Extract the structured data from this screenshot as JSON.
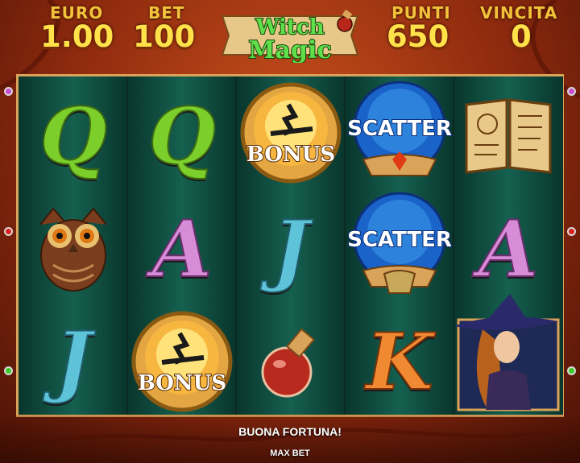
{
  "header": {
    "euro_label": "EURO",
    "euro_value": "1.00",
    "bet_label": "BET",
    "bet_value": "100",
    "punti_label": "PUNTI",
    "punti_value": "650",
    "vincita_label": "VINCITA",
    "vincita_value": "0"
  },
  "logo": {
    "line1": "Witch",
    "line2": "Magic"
  },
  "reels": [
    {
      "symbols": [
        {
          "type": "letter",
          "text": "Q",
          "style": "q"
        },
        {
          "type": "owl",
          "name": "owl-icon"
        },
        {
          "type": "letter",
          "text": "J",
          "style": "j"
        }
      ]
    },
    {
      "symbols": [
        {
          "type": "letter",
          "text": "Q",
          "style": "q"
        },
        {
          "type": "letter",
          "text": "A",
          "style": "a"
        },
        {
          "type": "bonus",
          "text": "BONUS"
        }
      ]
    },
    {
      "symbols": [
        {
          "type": "bonus",
          "text": "BONUS"
        },
        {
          "type": "letter",
          "text": "J",
          "style": "j"
        },
        {
          "type": "potion",
          "name": "potion-icon"
        }
      ]
    },
    {
      "symbols": [
        {
          "type": "scatter",
          "text": "SCATTER"
        },
        {
          "type": "scatter",
          "text": "SCATTER"
        },
        {
          "type": "letter",
          "text": "K",
          "style": "k"
        }
      ]
    },
    {
      "symbols": [
        {
          "type": "book",
          "name": "spellbook-icon"
        },
        {
          "type": "letter",
          "text": "A",
          "style": "a"
        },
        {
          "type": "witch",
          "name": "witch-icon"
        }
      ]
    }
  ],
  "footer": {
    "message": "BUONA FORTUNA!",
    "max_bet": "MAX BET"
  },
  "colors": {
    "accent_gold": "#f4c23a",
    "reel_bg": "#0f4b3e",
    "frame": "#d9a35a"
  }
}
